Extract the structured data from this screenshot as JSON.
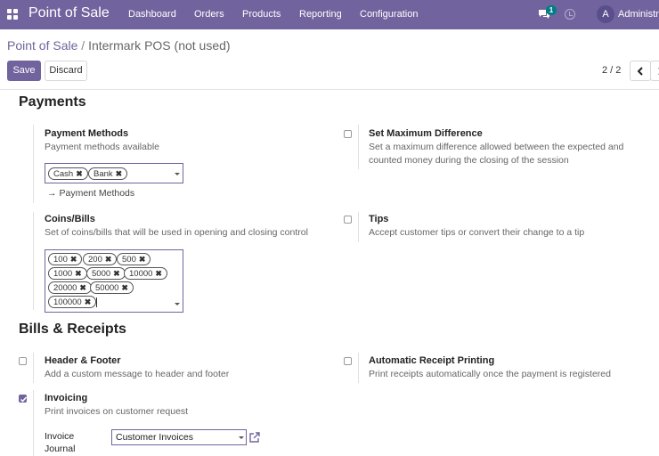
{
  "navbar": {
    "brand": "Point of Sale",
    "menu": [
      "Dashboard",
      "Orders",
      "Products",
      "Reporting",
      "Configuration"
    ],
    "chat_count": "1",
    "avatar_letter": "A",
    "user_name": "Administrator"
  },
  "breadcrumb": {
    "parent": "Point of Sale",
    "separator": "/",
    "current": "Intermark POS (not used)"
  },
  "actions": {
    "save": "Save",
    "discard": "Discard"
  },
  "pager": {
    "text": "2 / 2"
  },
  "payments": {
    "title": "Payments",
    "payment_methods": {
      "title": "Payment Methods",
      "desc": "Payment methods available",
      "tags": [
        "Cash",
        "Bank"
      ],
      "link": "Payment Methods"
    },
    "max_difference": {
      "title": "Set Maximum Difference",
      "desc": "Set a maximum difference allowed between the expected and counted money during the closing of the session",
      "checked": false
    },
    "coins_bills": {
      "title": "Coins/Bills",
      "desc": "Set of coins/bills that will be used in opening and closing control",
      "tags": [
        "100",
        "200",
        "500",
        "1000",
        "5000",
        "10000",
        "20000",
        "50000",
        "100000"
      ]
    },
    "tips": {
      "title": "Tips",
      "desc": "Accept customer tips or convert their change to a tip",
      "checked": false
    }
  },
  "bills_receipts": {
    "title": "Bills & Receipts",
    "header_footer": {
      "title": "Header & Footer",
      "desc": "Add a custom message to header and footer",
      "checked": false
    },
    "auto_print": {
      "title": "Automatic Receipt Printing",
      "desc": "Print receipts automatically once the payment is registered",
      "checked": false
    },
    "invoicing": {
      "title": "Invoicing",
      "desc": "Print invoices on customer request",
      "checked": true,
      "journal_label": "Invoice Journal",
      "journal_value": "Customer Invoices"
    }
  },
  "colors": {
    "primary": "#71639e",
    "badge": "#017e84"
  }
}
